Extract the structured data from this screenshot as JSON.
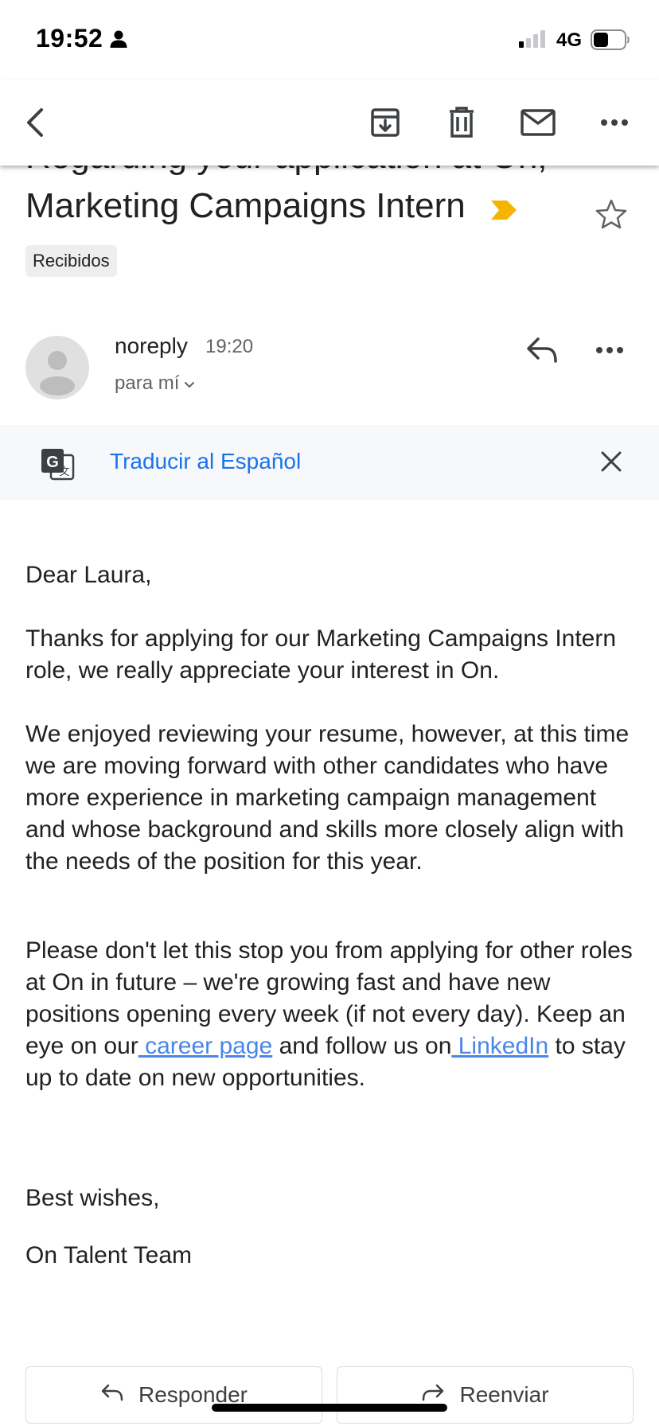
{
  "status_bar": {
    "time": "19:52",
    "network": "4G",
    "icons": [
      "person-icon",
      "signal-icon",
      "battery-icon"
    ]
  },
  "toolbar": {
    "icons": [
      "back-arrow-icon",
      "archive-icon",
      "trash-icon",
      "mail-icon",
      "more-icon"
    ]
  },
  "subject": {
    "line1": "Regarding your application at On,",
    "line2": "Marketing Campaigns Intern",
    "label": "Recibidos",
    "importance_color": "#f4b400"
  },
  "sender": {
    "name": "noreply",
    "time": "19:20",
    "recipient": "para mí"
  },
  "translate": {
    "label": "Traducir al Español"
  },
  "body": {
    "greeting": "Dear Laura,",
    "p1": "Thanks for applying for our Marketing Campaigns Intern role, we really appreciate your interest in On.",
    "p2": "We enjoyed reviewing your resume, however, at this time we are moving forward with other candidates who have more experience in marketing campaign management and whose background and skills more closely align with the needs of the position for this year.",
    "p3_a": "Please don't let this stop you from applying for other roles at On in future – we're growing fast and have new positions opening every week (if not every day). Keep an eye on our",
    "p3_link1": " career page",
    "p3_b": " and follow us on",
    "p3_link2": " LinkedIn",
    "p3_c": " to stay up to date on new opportunities.",
    "sign_off": "Best wishes,",
    "team": "On Talent Team"
  },
  "actions": {
    "reply": "Responder",
    "forward": "Reenviar"
  },
  "colors": {
    "link": "#4a86e8",
    "translate_link": "#1a73e8",
    "importance": "#f4b400"
  }
}
